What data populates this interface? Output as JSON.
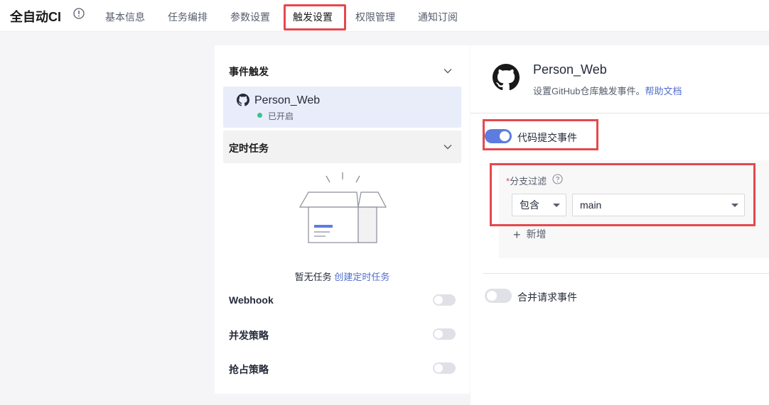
{
  "header": {
    "app_title": "全自动CI",
    "tabs": [
      {
        "label": "基本信息"
      },
      {
        "label": "任务编排"
      },
      {
        "label": "参数设置"
      },
      {
        "label": "触发设置"
      },
      {
        "label": "权限管理"
      },
      {
        "label": "通知订阅"
      }
    ],
    "active_tab": "触发设置"
  },
  "left": {
    "event_trigger_title": "事件触发",
    "repo": {
      "name": "Person_Web",
      "status": "已开启"
    },
    "timer_title": "定时任务",
    "empty": {
      "text": "暂无任务",
      "link": "创建定时任务"
    },
    "rows": [
      {
        "label": "Webhook"
      },
      {
        "label": "并发策略"
      },
      {
        "label": "抢占策略"
      }
    ]
  },
  "right": {
    "repo_name": "Person_Web",
    "description": "设置GitHub仓库触发事件。",
    "help_link": "帮助文档",
    "commit_event": {
      "label": "代码提交事件",
      "enabled": true
    },
    "branch_filter": {
      "required_mark": "*",
      "label": "分支过滤",
      "mode": "包含",
      "branch": "main",
      "add_label": "新增"
    },
    "merge_event": {
      "label": "合并请求事件",
      "enabled": false
    }
  },
  "colors": {
    "accent": "#5e7ce0",
    "highlight": "#e5484d",
    "link": "#526ecc",
    "status_green": "#3ac295"
  }
}
